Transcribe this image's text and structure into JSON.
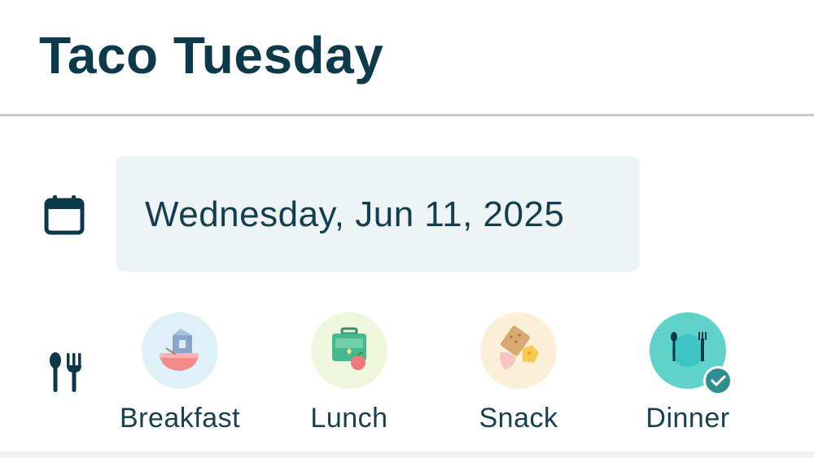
{
  "header": {
    "title": "Taco Tuesday"
  },
  "date_field": {
    "value": "Wednesday, Jun 11, 2025",
    "icon": "calendar-icon"
  },
  "meal_type": {
    "icon": "fork-knife-icon",
    "options": [
      {
        "label": "Breakfast",
        "icon": "breakfast-icon",
        "selected": false,
        "color": "#dff1f8"
      },
      {
        "label": "Lunch",
        "icon": "lunchbox-icon",
        "selected": false,
        "color": "#eef7dc"
      },
      {
        "label": "Snack",
        "icon": "snack-icon",
        "selected": false,
        "color": "#fbefd8"
      },
      {
        "label": "Dinner",
        "icon": "dinner-icon",
        "selected": true,
        "color": "#5fd2c9"
      }
    ]
  }
}
